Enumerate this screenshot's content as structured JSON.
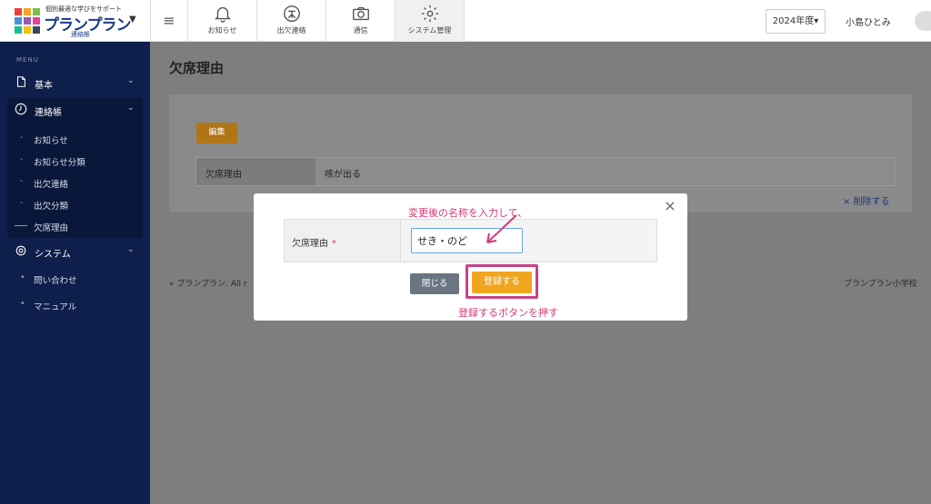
{
  "header": {
    "logo_tagline": "個別最適な学びをサポート",
    "logo_name": "プランプラン",
    "logo_sub": "連絡帳",
    "tabs": [
      {
        "label": "お知らせ",
        "icon": "bell-icon"
      },
      {
        "label": "出欠連絡",
        "icon": "attendance-icon"
      },
      {
        "label": "通信",
        "icon": "camera-icon"
      },
      {
        "label": "システム管理",
        "icon": "gear-icon"
      }
    ],
    "year_select": "2024年度",
    "user_name": "小島ひとみ"
  },
  "sidebar": {
    "menu_label": "MENU",
    "items": [
      {
        "label": "基本",
        "icon": "document-icon"
      },
      {
        "label": "連絡帳",
        "icon": "clock-icon"
      },
      {
        "label": "システム",
        "icon": "gear-icon"
      }
    ],
    "renrakucho_sub": [
      "お知らせ",
      "お知らせ分類",
      "出欠連絡",
      "出欠分類",
      "欠席理由"
    ],
    "system_sub": [
      "問い合わせ",
      "マニュアル"
    ]
  },
  "main": {
    "title": "欠席理由",
    "edit_label": "編集",
    "row_key": "欠席理由",
    "row_value": "咳が出る",
    "delete_label": "削除する",
    "footer_left": "プランプラン. All r",
    "footer_right": "プランプラン小学校"
  },
  "modal": {
    "hint_top": "変更後の名称を入力して、",
    "field_label": "欠席理由",
    "required_mark": "*",
    "input_value": "せき・のど",
    "close_label": "閉じる",
    "register_label": "登録する",
    "hint_bottom": "登録するボタンを押す",
    "accent_color": "#d43a78"
  }
}
